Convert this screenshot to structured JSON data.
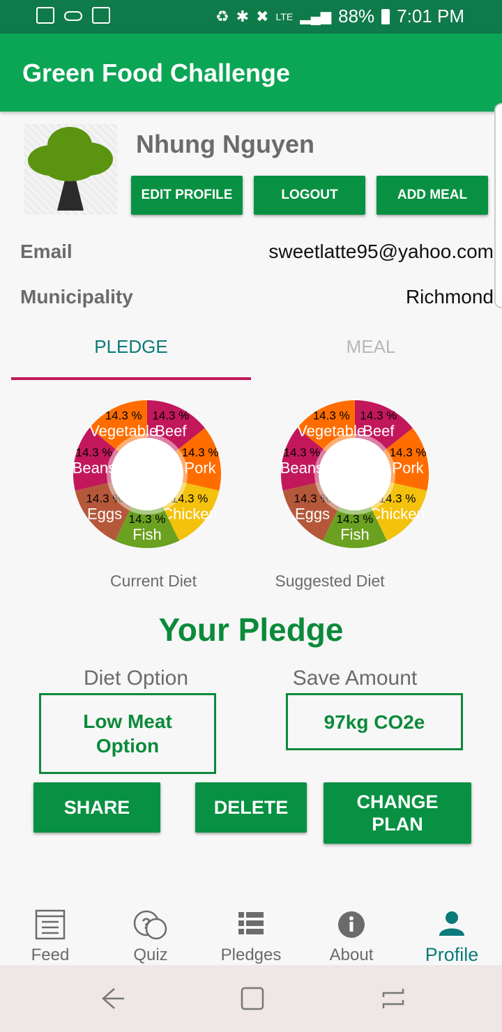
{
  "status_bar": {
    "battery": "88%",
    "time": "7:01 PM",
    "network": "LTE"
  },
  "app_bar": {
    "title": "Green Food Challenge"
  },
  "profile": {
    "name": "Nhung Nguyen",
    "buttons": {
      "edit": "EDIT PROFILE",
      "logout": "LOGOUT",
      "add_meal": "ADD MEAL"
    },
    "email_label": "Email",
    "email_value": "sweetlatte95@yahoo.com",
    "municipality_label": "Municipality",
    "municipality_value": "Richmond"
  },
  "tabs": [
    {
      "label": "PLEDGE",
      "active": true
    },
    {
      "label": "MEAL",
      "active": false
    }
  ],
  "chart_data": [
    {
      "type": "pie",
      "title": "Current Diet",
      "categories": [
        "Beef",
        "Pork",
        "Chicken",
        "Fish",
        "Eggs",
        "Beans",
        "Vegetable"
      ],
      "values": [
        14.3,
        14.3,
        14.3,
        14.3,
        14.3,
        14.3,
        14.3
      ],
      "value_labels": [
        "14.3 %",
        "14.3 %",
        "14.3 %",
        "14.3 %",
        "14.3 %",
        "14.3 %",
        "14.3 %"
      ],
      "colors": [
        "#c2185b",
        "#ff6d00",
        "#f4c20d",
        "#6aa121",
        "#b5583a",
        "#c2185b",
        "#ff6d00"
      ],
      "legend": "none",
      "hole": true
    },
    {
      "type": "pie",
      "title": "Suggested Diet",
      "categories": [
        "Beef",
        "Pork",
        "Chicken",
        "Fish",
        "Eggs",
        "Beans",
        "Vegetable"
      ],
      "values": [
        14.3,
        14.3,
        14.3,
        14.3,
        14.3,
        14.3,
        14.3
      ],
      "value_labels": [
        "14.3 %",
        "14.3 %",
        "14.3 %",
        "14.3 %",
        "14.3 %",
        "14.3 %",
        "14.3 %"
      ],
      "colors": [
        "#c2185b",
        "#ff6d00",
        "#f4c20d",
        "#6aa121",
        "#b5583a",
        "#c2185b",
        "#ff6d00"
      ],
      "legend": "none",
      "hole": true
    }
  ],
  "pledge": {
    "title": "Your Pledge",
    "diet_option_label": "Diet Option",
    "diet_option_value": "Low Meat Option",
    "save_amount_label": "Save Amount",
    "save_amount_value": "97kg CO2e",
    "buttons": {
      "share": "SHARE",
      "delete": "DELETE",
      "change_plan": "CHANGE PLAN"
    }
  },
  "bottom_nav": [
    {
      "label": "Feed",
      "icon": "feed-icon",
      "active": false
    },
    {
      "label": "Quiz",
      "icon": "quiz-icon",
      "active": false
    },
    {
      "label": "Pledges",
      "icon": "pledges-icon",
      "active": false
    },
    {
      "label": "About",
      "icon": "about-icon",
      "active": false
    },
    {
      "label": "Profile",
      "icon": "profile-icon",
      "active": true
    }
  ],
  "colors": {
    "primary": "#0aa555",
    "button": "#089142",
    "accent": "#c2185b",
    "tab_active": "#0b7a7a"
  }
}
